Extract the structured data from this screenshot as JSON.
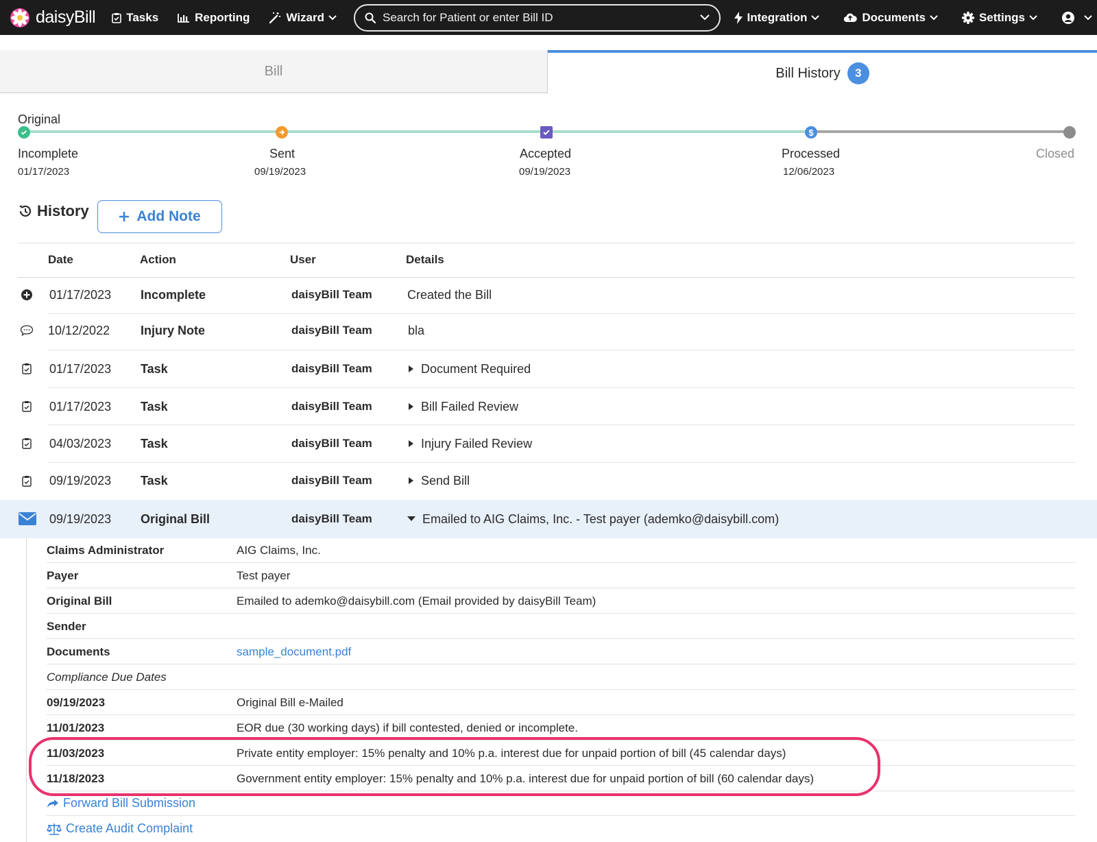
{
  "nav": {
    "brand": "daisyBill",
    "tasks": "Tasks",
    "reporting": "Reporting",
    "wizard": "Wizard",
    "search_placeholder": "Search for Patient or enter Bill ID",
    "integration": "Integration",
    "documents": "Documents",
    "settings": "Settings"
  },
  "tabs": {
    "bill": "Bill",
    "history": "Bill History",
    "history_count": "3"
  },
  "timeline": {
    "title": "Original",
    "steps": [
      {
        "label": "Incomplete",
        "date": "01/17/2023",
        "color": "#3cbf8a"
      },
      {
        "label": "Sent",
        "date": "09/19/2023",
        "color": "#f29a2e"
      },
      {
        "label": "Accepted",
        "date": "09/19/2023",
        "color": "#6a5bc2"
      },
      {
        "label": "Processed",
        "date": "12/06/2023",
        "color": "#4a8fe0"
      },
      {
        "label": "Closed",
        "date": "",
        "color": "#8c8c8c"
      }
    ]
  },
  "history": {
    "title": "History",
    "add_note": "Add Note",
    "columns": {
      "date": "Date",
      "action": "Action",
      "user": "User",
      "details": "Details"
    },
    "rows": [
      {
        "icon": "plus-circle-icon",
        "date": "01/17/2023",
        "action": "Incomplete",
        "user": "daisyBill Team",
        "details": "Created the Bill"
      },
      {
        "icon": "comment-icon",
        "date": "10/12/2022",
        "action": "Injury Note",
        "user": "daisyBill Team",
        "details": "bla"
      },
      {
        "icon": "task-clipboard-icon",
        "date": "01/17/2023",
        "action": "Task",
        "user": "daisyBill Team",
        "details": "Document Required"
      },
      {
        "icon": "task-clipboard-icon",
        "date": "01/17/2023",
        "action": "Task",
        "user": "daisyBill Team",
        "details": "Bill Failed Review"
      },
      {
        "icon": "task-clipboard-icon",
        "date": "04/03/2023",
        "action": "Task",
        "user": "daisyBill Team",
        "details": "Injury Failed Review"
      },
      {
        "icon": "task-clipboard-icon",
        "date": "09/19/2023",
        "action": "Task",
        "user": "daisyBill Team",
        "details": "Send Bill"
      },
      {
        "icon": "envelope-icon",
        "date": "09/19/2023",
        "action": "Original Bill",
        "user": "daisyBill Team",
        "details": "Emailed to AIG Claims, Inc. - Test payer (ademko@daisybill.com)"
      }
    ]
  },
  "detail": {
    "claims_admin_label": "Claims Administrator",
    "claims_admin_value": "AIG Claims, Inc.",
    "payer_label": "Payer",
    "payer_value": "Test payer",
    "original_bill_label": "Original Bill",
    "original_bill_value": "Emailed to ademko@daisybill.com (Email provided by daisyBill Team)",
    "sender_label": "Sender",
    "documents_label": "Documents",
    "documents_value": "sample_document.pdf",
    "compliance_label": "Compliance Due Dates",
    "due_dates": [
      {
        "date": "09/19/2023",
        "text": "Original Bill e-Mailed"
      },
      {
        "date": "11/01/2023",
        "text": "EOR due (30 working days) if bill contested, denied or incomplete."
      },
      {
        "date": "11/03/2023",
        "text": "Private entity employer: 15% penalty and 10% p.a. interest due for unpaid portion of bill (45 calendar days)"
      },
      {
        "date": "11/18/2023",
        "text": "Government entity employer: 15% penalty and 10% p.a. interest due for unpaid portion of bill (60 calendar days)"
      }
    ],
    "forward_link": "Forward Bill Submission",
    "audit_link": "Create Audit Complaint"
  }
}
